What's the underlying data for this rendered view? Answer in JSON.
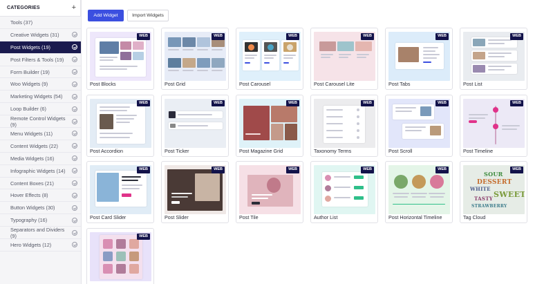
{
  "sidebar": {
    "title": "CATEGORIES",
    "add_icon": "+",
    "items": [
      {
        "label": "Tools (37)"
      },
      {
        "label": "Creative Widgets (31)"
      },
      {
        "label": "Post Widgets (19)"
      },
      {
        "label": "Post Filters & Tools (19)"
      },
      {
        "label": "Form Builder (19)"
      },
      {
        "label": "Woo Widgets (9)"
      },
      {
        "label": "Marketing Widgets (54)"
      },
      {
        "label": "Loop Builder (6)"
      },
      {
        "label": "Remote Control Widgets (9)"
      },
      {
        "label": "Menu Widgets (11)"
      },
      {
        "label": "Content Widgets (22)"
      },
      {
        "label": "Media Widgets (16)"
      },
      {
        "label": "Infographic Widgets (14)"
      },
      {
        "label": "Content Boxes (21)"
      },
      {
        "label": "Hover Effects (8)"
      },
      {
        "label": "Button Widgets (30)"
      },
      {
        "label": "Typography (16)"
      },
      {
        "label": "Separators and Dividers (9)"
      },
      {
        "label": "Hero Widgets (12)"
      }
    ],
    "active_index": 2
  },
  "toolbar": {
    "add_label": "Add Widget",
    "import_label": "Import Widgets"
  },
  "badge": "WEB",
  "colors": {
    "accent": "#3b4fe0",
    "active_category": "#1a1a4e",
    "badge": "#12124a"
  },
  "widgets": [
    {
      "label": "Post Blocks"
    },
    {
      "label": "Post Grid"
    },
    {
      "label": "Post Carousel"
    },
    {
      "label": "Post Carousel Lite"
    },
    {
      "label": "Post Tabs"
    },
    {
      "label": "Post List"
    },
    {
      "label": "Post Accordion"
    },
    {
      "label": "Post Ticker"
    },
    {
      "label": "Post Magazine Grid"
    },
    {
      "label": "Taxonomy Terms"
    },
    {
      "label": "Post Scroll"
    },
    {
      "label": "Post Timeline"
    },
    {
      "label": "Post Card Slider"
    },
    {
      "label": "Post Slider"
    },
    {
      "label": "Post Tile"
    },
    {
      "label": "Author List"
    },
    {
      "label": "Post Horizontal Timeline"
    },
    {
      "label": "Tag Cloud"
    },
    {
      "label": ""
    }
  ],
  "tag_cloud_words": [
    "SOUR",
    "DESSERT",
    "WHITE",
    "SWEET",
    "TASTY",
    "STRAWBERRY"
  ]
}
